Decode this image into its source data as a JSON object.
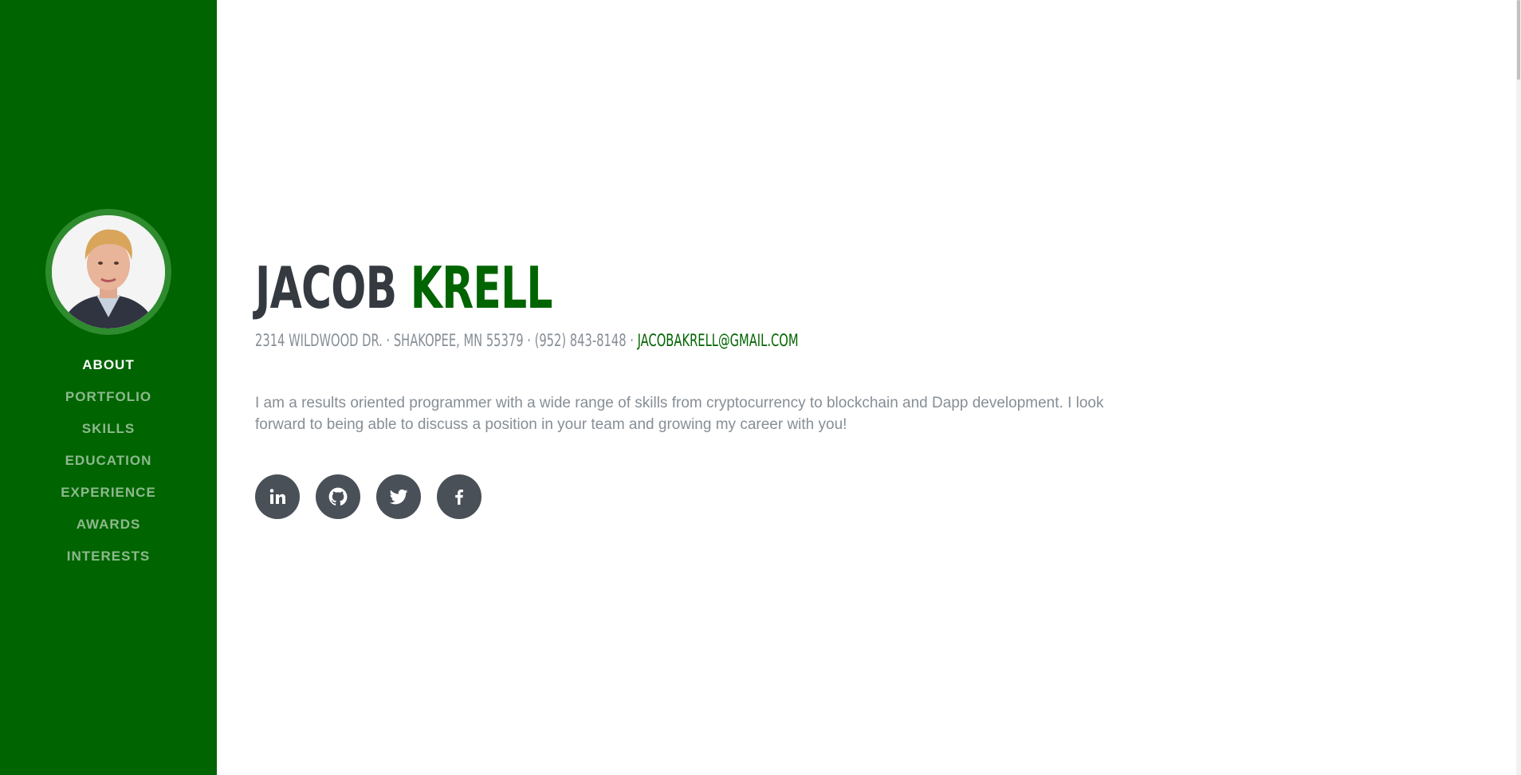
{
  "sidebar": {
    "nav": [
      {
        "label": "About",
        "active": true
      },
      {
        "label": "Portfolio",
        "active": false
      },
      {
        "label": "Skills",
        "active": false
      },
      {
        "label": "Education",
        "active": false
      },
      {
        "label": "Experience",
        "active": false
      },
      {
        "label": "Awards",
        "active": false
      },
      {
        "label": "Interests",
        "active": false
      }
    ]
  },
  "header": {
    "first_name": "Jacob",
    "last_name": "Krell",
    "address": "2314 Wildwood Dr. · Shakopee, MN 55379 · (952) 843-8148 ·",
    "email": "jacobakrell@gmail.com"
  },
  "about": {
    "text": "I am a results oriented programmer with a wide range of skills from cryptocurrency to blockchain and Dapp development. I look forward to being able to discuss a position in your team and growing my career with you!"
  },
  "socials": [
    {
      "icon": "linkedin-icon"
    },
    {
      "icon": "github-icon"
    },
    {
      "icon": "twitter-icon"
    },
    {
      "icon": "facebook-icon"
    }
  ],
  "colors": {
    "primary": "#006400",
    "sidebar_bg": "#006400",
    "heading": "#343a40",
    "muted": "#868e96",
    "social_bg": "#495057"
  }
}
